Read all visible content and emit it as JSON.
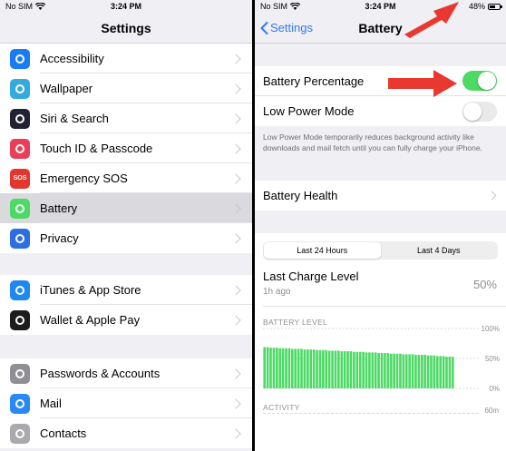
{
  "status": {
    "carrier": "No SIM",
    "time": "3:24 PM",
    "battery_percent": "48%",
    "battery_level": 0.48
  },
  "left": {
    "title": "Settings",
    "group1": [
      {
        "label": "Accessibility",
        "icon": "accessibility-icon",
        "color": "#1a7cf5"
      },
      {
        "label": "Wallpaper",
        "icon": "wallpaper-icon",
        "color": "#35aadc"
      },
      {
        "label": "Siri & Search",
        "icon": "siri-icon",
        "color": "#222233"
      },
      {
        "label": "Touch ID & Passcode",
        "icon": "fingerprint-icon",
        "color": "#e83e5a"
      },
      {
        "label": "Emergency SOS",
        "icon": "sos-icon",
        "color": "#e3362f",
        "glyph": "SOS"
      },
      {
        "label": "Battery",
        "icon": "battery-icon",
        "color": "#4cd964"
      },
      {
        "label": "Privacy",
        "icon": "hand-icon",
        "color": "#2d6fe0"
      }
    ],
    "group2": [
      {
        "label": "iTunes & App Store",
        "icon": "app-store-icon",
        "color": "#1e88f0"
      },
      {
        "label": "Wallet & Apple Pay",
        "icon": "wallet-icon",
        "color": "#1c1c1e"
      }
    ],
    "group3": [
      {
        "label": "Passwords & Accounts",
        "icon": "key-icon",
        "color": "#8e8e93"
      },
      {
        "label": "Mail",
        "icon": "mail-icon",
        "color": "#2a8af5"
      },
      {
        "label": "Contacts",
        "icon": "contacts-icon",
        "color": "#a9a9ae"
      }
    ]
  },
  "right": {
    "back_label": "Settings",
    "title": "Battery",
    "battery_percentage_label": "Battery Percentage",
    "battery_percentage_on": true,
    "low_power_label": "Low Power Mode",
    "low_power_on": false,
    "low_power_footnote": "Low Power Mode temporarily reduces background activity like downloads and mail fetch until you can fully charge your iPhone.",
    "battery_health_label": "Battery Health",
    "tabs": [
      "Last 24 Hours",
      "Last 4 Days"
    ],
    "last_charge_label": "Last Charge Level",
    "last_charge_time": "1h ago",
    "last_charge_value": "50%",
    "battery_level_heading": "BATTERY LEVEL",
    "activity_heading": "ACTIVITY"
  },
  "chart_data": {
    "type": "bar",
    "title": "BATTERY LEVEL",
    "ytick_labels": [
      "100%",
      "50%",
      "0%"
    ],
    "ylim": [
      0,
      100
    ],
    "values": [
      69,
      69,
      68,
      68,
      68,
      67,
      67,
      67,
      67,
      66,
      66,
      66,
      66,
      65,
      65,
      65,
      65,
      64,
      64,
      64,
      64,
      63,
      63,
      63,
      63,
      62,
      62,
      62,
      62,
      61,
      61,
      61,
      61,
      60,
      60,
      60,
      60,
      59,
      59,
      59,
      59,
      58,
      58,
      58,
      58,
      57,
      57,
      57,
      57,
      56,
      56,
      56,
      56,
      55,
      55,
      55,
      54,
      54,
      54,
      53,
      53,
      53
    ],
    "grid": true,
    "color": "#4cd964",
    "activity_ytick_label": "60m"
  }
}
